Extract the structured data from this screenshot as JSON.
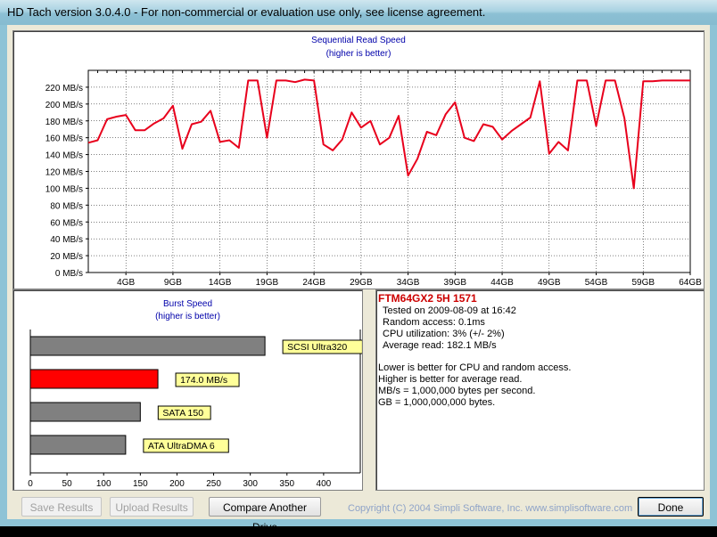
{
  "window": {
    "title": "HD Tach version 3.0.4.0  - For non-commercial or evaluation use only, see license agreement."
  },
  "sequential": {
    "title": "Sequential Read Speed",
    "subtitle": "(higher is better)"
  },
  "burst": {
    "title": "Burst Speed",
    "subtitle": "(higher is better)"
  },
  "chart_data": [
    {
      "type": "line",
      "title": "Sequential Read Speed",
      "subtitle": "(higher is better)",
      "y_unit": "MB/s",
      "ylim": [
        0,
        240
      ],
      "y_ticks": [
        0,
        20,
        40,
        60,
        80,
        100,
        120,
        140,
        160,
        180,
        200,
        220
      ],
      "y_tick_labels": [
        "0 MB/s",
        "20 MB/s",
        "40 MB/s",
        "60 MB/s",
        "80 MB/s",
        "100 MB/s",
        "120 MB/s",
        "140 MB/s",
        "160 MB/s",
        "180 MB/s",
        "200 MB/s",
        "220 MB/s"
      ],
      "xlim": [
        0,
        64
      ],
      "x_tick_labels": [
        "4GB",
        "9GB",
        "14GB",
        "19GB",
        "24GB",
        "29GB",
        "34GB",
        "39GB",
        "44GB",
        "49GB",
        "54GB",
        "59GB",
        "64GB"
      ],
      "x_tick_values": [
        4,
        9,
        14,
        19,
        24,
        29,
        34,
        39,
        44,
        49,
        54,
        59,
        64
      ],
      "grid": true,
      "color": "#e8001c",
      "x": [
        0,
        1,
        2,
        3,
        4,
        5,
        6,
        7,
        8,
        9,
        10,
        11,
        12,
        13,
        14,
        15,
        16,
        17,
        18,
        19,
        20,
        21,
        22,
        23,
        24,
        25,
        26,
        27,
        28,
        29,
        30,
        31,
        32,
        33,
        34,
        35,
        36,
        37,
        38,
        39,
        40,
        41,
        42,
        43,
        44,
        45,
        46,
        47,
        48,
        49,
        50,
        51,
        52,
        53,
        54,
        55,
        56,
        57,
        58,
        59,
        60,
        61,
        62,
        63,
        64
      ],
      "y": [
        154,
        157,
        182,
        185,
        187,
        169,
        169,
        177,
        183,
        198,
        147,
        176,
        179,
        192,
        155,
        157,
        148,
        228,
        228,
        160,
        228,
        228,
        226,
        229,
        228,
        152,
        145,
        158,
        190,
        172,
        180,
        152,
        160,
        186,
        115,
        135,
        167,
        163,
        188,
        202,
        160,
        156,
        176,
        173,
        158,
        168,
        176,
        184,
        227,
        141,
        155,
        145,
        228,
        228,
        174,
        228,
        228,
        183,
        100,
        227,
        227,
        228,
        228,
        228,
        228
      ]
    },
    {
      "type": "bar",
      "orientation": "horizontal",
      "title": "Burst Speed",
      "subtitle": "(higher is better)",
      "xlim": [
        0,
        450
      ],
      "x_ticks": [
        0,
        50,
        100,
        150,
        200,
        250,
        300,
        350,
        400
      ],
      "categories": [
        "SCSI Ultra320",
        "174.0 MB/s",
        "SATA 150",
        "ATA UltraDMA 6"
      ],
      "values": [
        320,
        174,
        150,
        130
      ],
      "colors": [
        "#808080",
        "#ff0000",
        "#808080",
        "#808080"
      ]
    }
  ],
  "results": {
    "drive": "FTM64GX2 5H 1571",
    "lines": [
      "Tested on 2009-08-09 at 16:42",
      "Random access: 0.1ms",
      "CPU utilization: 3% (+/- 2%)",
      "Average read: 182.1 MB/s"
    ],
    "notes": [
      "Lower is better for CPU and random access.",
      "Higher is better for average read.",
      "MB/s = 1,000,000 bytes per second.",
      "GB = 1,000,000,000 bytes."
    ],
    "drive_color": "#cc0000"
  },
  "buttons": {
    "save": "Save Results",
    "upload": "Upload Results",
    "compare": "Compare Another Drive",
    "done": "Done"
  },
  "copyright": "Copyright (C) 2004 Simpli Software, Inc. www.simplisoftware.com"
}
